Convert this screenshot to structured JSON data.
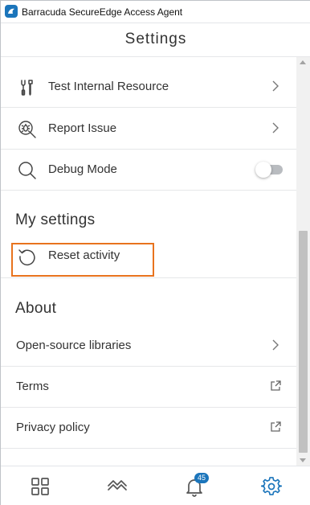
{
  "window": {
    "title": "Barracuda SecureEdge Access Agent"
  },
  "header": {
    "title": "Settings"
  },
  "content": {
    "cut_off_text": "",
    "items_top": [
      {
        "label": "Test Internal Resource",
        "icon": "tools-icon"
      },
      {
        "label": "Report Issue",
        "icon": "bug-report-icon"
      },
      {
        "label": "Debug Mode",
        "icon": "search-icon",
        "toggle_on": false
      }
    ],
    "my_settings": {
      "title": "My settings",
      "reset_label": "Reset activity"
    },
    "about": {
      "title": "About",
      "items": [
        {
          "label": "Open-source libraries"
        },
        {
          "label": "Terms"
        },
        {
          "label": "Privacy policy"
        }
      ]
    }
  },
  "bottom_nav": {
    "items": [
      "dashboard-grid-icon",
      "activity-chart-icon",
      "notifications-bell-icon",
      "settings-gear-icon"
    ],
    "notification_count": "45",
    "active": "settings"
  },
  "colors": {
    "accent": "#1b75bb",
    "highlight": "#e8731e",
    "text": "#333333"
  }
}
